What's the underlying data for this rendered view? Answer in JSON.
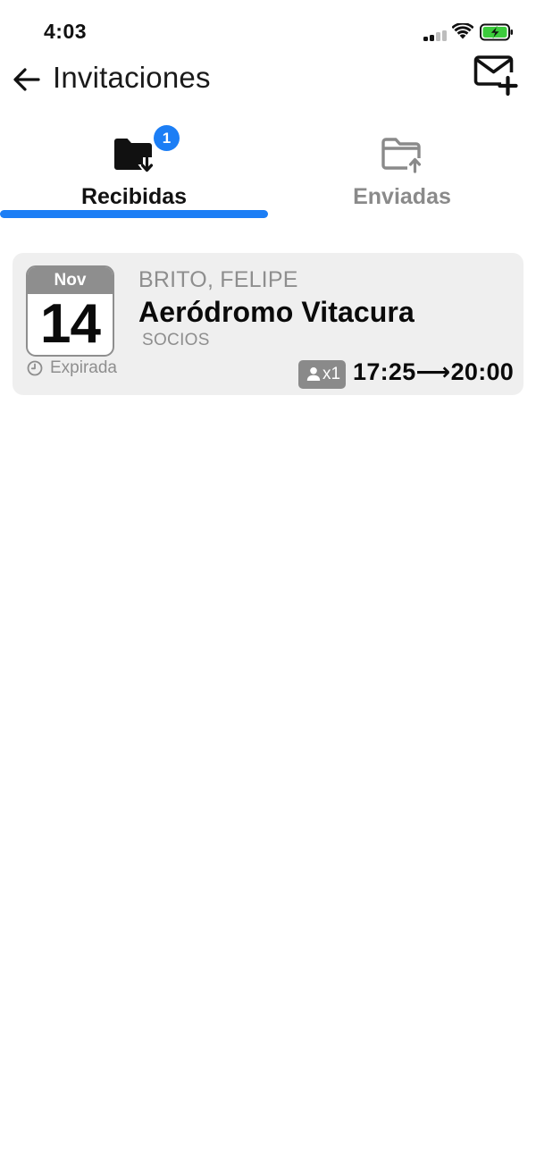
{
  "status_bar": {
    "time": "4:03",
    "icons": [
      "signal-icon",
      "wifi-icon",
      "battery-charging-icon"
    ]
  },
  "header": {
    "title": "Invitaciones",
    "back_icon": "arrow-left-icon",
    "action_icon": "mail-plus-icon"
  },
  "tabs": [
    {
      "label": "Recibidas",
      "icon": "folder-download-icon",
      "badge": "1",
      "active": true
    },
    {
      "label": "Enviadas",
      "icon": "folder-upload-icon",
      "active": false
    }
  ],
  "invitations": [
    {
      "month": "Nov",
      "day": "14",
      "status": "Expirada",
      "host": "BRITO, FELIPE",
      "place": "Aeródromo Vitacura",
      "category": "SOCIOS",
      "guests": "x1",
      "time_range": "17:25⟶20:00"
    }
  ],
  "colors": {
    "accent": "#1c7ef5",
    "muted": "#8e8e8e",
    "card_bg": "#efefef",
    "battery_green": "#3ccb3c"
  }
}
